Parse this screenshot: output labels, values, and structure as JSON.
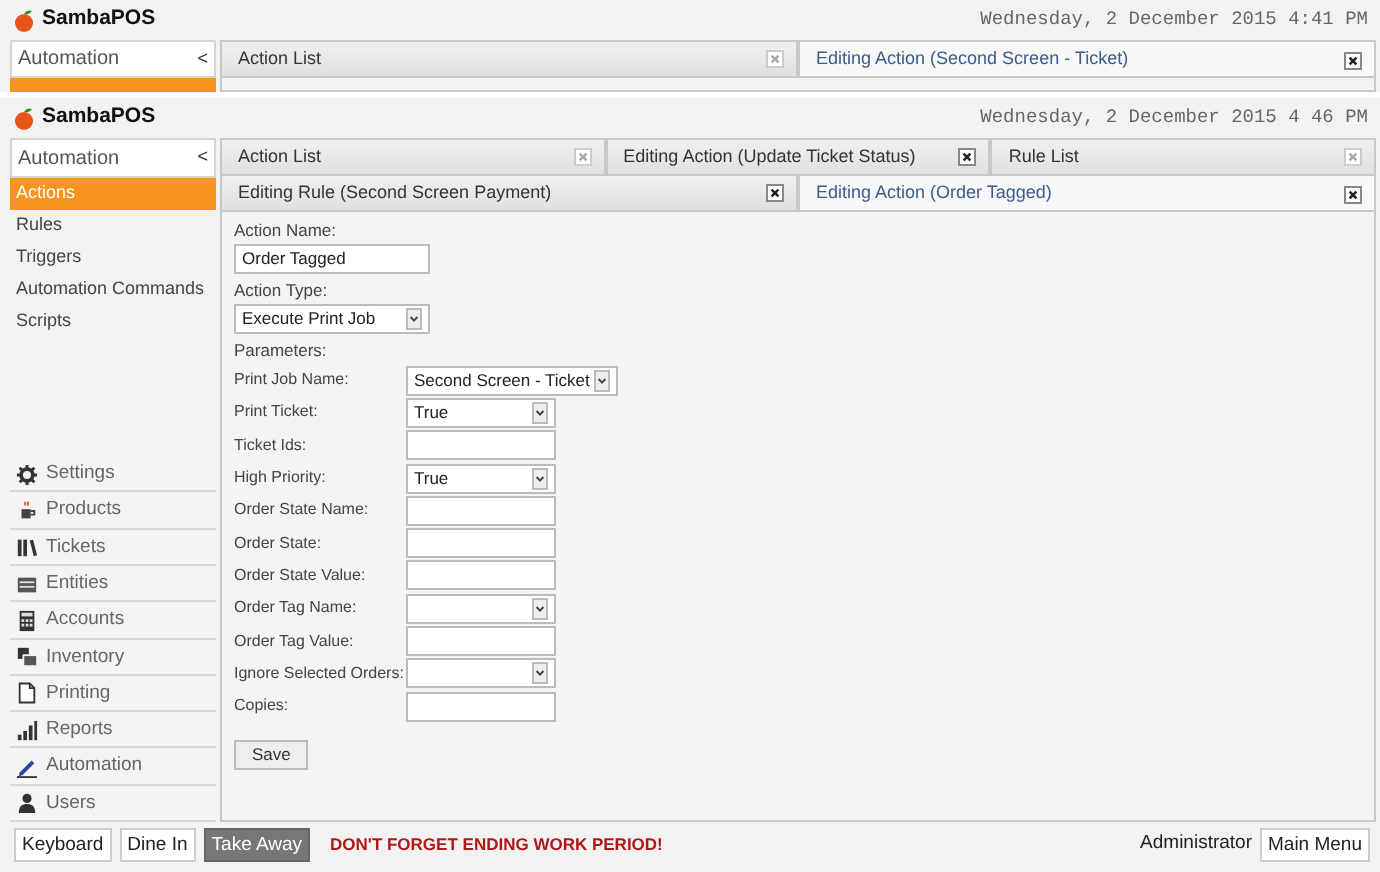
{
  "screens": [
    {
      "app_name": "SambaPOS",
      "datetime": "Wednesday, 2 December 2015 4:41 PM",
      "module_title": "Automation",
      "collapse_glyph": "<",
      "tab_rows": [
        [
          {
            "label": "Action List",
            "selected": false,
            "close_active": false
          },
          {
            "label": "Editing Action (Second Screen - Ticket)",
            "selected": true,
            "close_active": true
          }
        ]
      ]
    },
    {
      "app_name": "SambaPOS",
      "datetime": "Wednesday, 2 December 2015 4 46 PM",
      "module_title": "Automation",
      "collapse_glyph": "<",
      "module_items": [
        {
          "label": "Actions",
          "selected": true
        },
        {
          "label": "Rules",
          "selected": false
        },
        {
          "label": "Triggers",
          "selected": false
        },
        {
          "label": "Automation Commands",
          "selected": false
        },
        {
          "label": "Scripts",
          "selected": false
        }
      ],
      "main_menu": [
        {
          "label": "Settings"
        },
        {
          "label": "Products"
        },
        {
          "label": "Tickets"
        },
        {
          "label": "Entities"
        },
        {
          "label": "Accounts"
        },
        {
          "label": "Inventory"
        },
        {
          "label": "Printing"
        },
        {
          "label": "Reports"
        },
        {
          "label": "Automation"
        },
        {
          "label": "Users"
        }
      ],
      "tab_rows": [
        [
          {
            "label": "Action List",
            "selected": false,
            "close_active": false
          },
          {
            "label": "Editing Action (Update Ticket Status)",
            "selected": false,
            "close_active": true
          },
          {
            "label": "Rule List",
            "selected": false,
            "close_active": false
          }
        ],
        [
          {
            "label": "Editing Rule (Second Screen Payment)",
            "selected": false,
            "close_active": true
          },
          {
            "label": "Editing Action (Order Tagged)",
            "selected": true,
            "close_active": true
          }
        ]
      ],
      "form": {
        "top_fields": [
          {
            "label": "Action Name:",
            "kind": "text",
            "value": "Order Tagged"
          },
          {
            "label": "Action Type:",
            "kind": "select",
            "value": "Execute Print Job"
          }
        ],
        "parameters_label": "Parameters:",
        "parameters": [
          {
            "label": "Print Job Name:",
            "kind": "select",
            "value": "Second Screen - Ticket"
          },
          {
            "label": "Print Ticket:",
            "kind": "select",
            "value": "True"
          },
          {
            "label": "Ticket Ids:",
            "kind": "text"
          },
          {
            "label": "High Priority:",
            "kind": "select",
            "value": "True"
          },
          {
            "label": "Order State Name:",
            "kind": "text"
          },
          {
            "label": "Order State:",
            "kind": "text"
          },
          {
            "label": "Order State Value:",
            "kind": "text"
          },
          {
            "label": "Order Tag Name:",
            "kind": "select"
          },
          {
            "label": "Order Tag Value:",
            "kind": "text"
          },
          {
            "label": "Ignore Selected Orders:",
            "kind": "select"
          },
          {
            "label": "Copies:",
            "kind": "text"
          }
        ],
        "save_button": "Save"
      },
      "footer": {
        "buttons": [
          {
            "label": "Keyboard",
            "selected": false
          },
          {
            "label": "Dine In",
            "selected": false
          },
          {
            "label": "Take Away",
            "selected": true
          }
        ],
        "message": "DON'T FORGET ENDING WORK PERIOD!",
        "user": "Administrator",
        "menu_button": "Main Menu"
      }
    }
  ]
}
